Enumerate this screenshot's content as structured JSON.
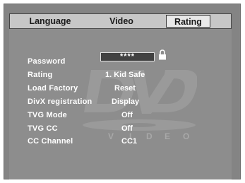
{
  "tabs": [
    "Language",
    "Video",
    "Rating"
  ],
  "active_tab": "Rating",
  "watermark": {
    "logo": "DVD",
    "sub": "VIDEO"
  },
  "settings": [
    {
      "label": "Password",
      "value": "****"
    },
    {
      "label": "Rating",
      "value": "1. Kid Safe"
    },
    {
      "label": "Load Factory",
      "value": "Reset"
    },
    {
      "label": "DivX registration",
      "value": "Display"
    },
    {
      "label": "TVG Mode",
      "value": "Off"
    },
    {
      "label": "TVG CC",
      "value": "Off"
    },
    {
      "label": "CC Channel",
      "value": "CC1"
    }
  ],
  "icons": {
    "lock": "lock-icon"
  },
  "colors": {
    "background": "#8d8d8d",
    "tabbar": "#c7c7c7",
    "active_tab": "#e9e9e9",
    "text": "#ffffff"
  }
}
